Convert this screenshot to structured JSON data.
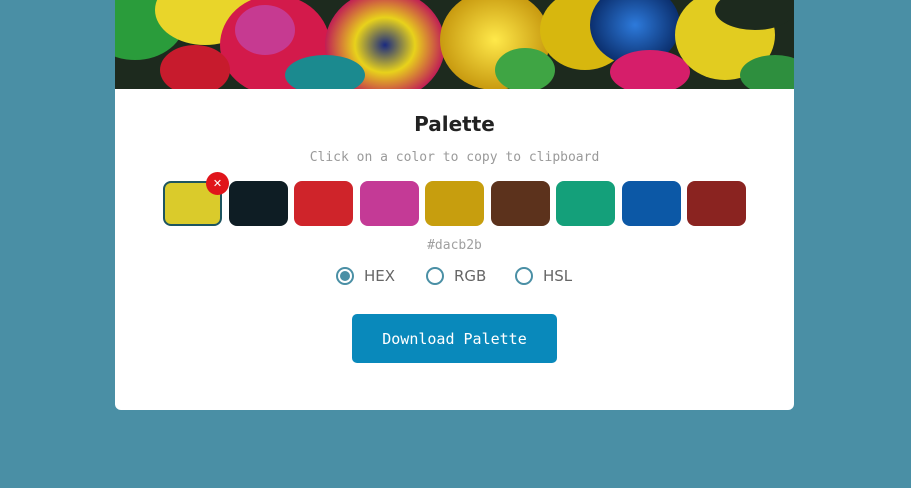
{
  "header": {
    "title": "Palette",
    "subtitle": "Click on a color to copy to clipboard"
  },
  "palette": {
    "colors": [
      "#dacb2b",
      "#0e1d24",
      "#cf242a",
      "#c43a96",
      "#c79e0e",
      "#5c321c",
      "#14a07a",
      "#0c58a6",
      "#8a2320"
    ],
    "selected_index": 0,
    "selected_value": "#dacb2b",
    "remove_icon": "close-icon",
    "remove_glyph": "✕"
  },
  "format": {
    "options": [
      {
        "label": "HEX",
        "checked": true
      },
      {
        "label": "RGB",
        "checked": false
      },
      {
        "label": "HSL",
        "checked": false
      }
    ]
  },
  "actions": {
    "download_label": "Download Palette"
  },
  "theme": {
    "background": "#4a8fa5",
    "accent": "#0989bb",
    "remove_color": "#e0151b"
  }
}
